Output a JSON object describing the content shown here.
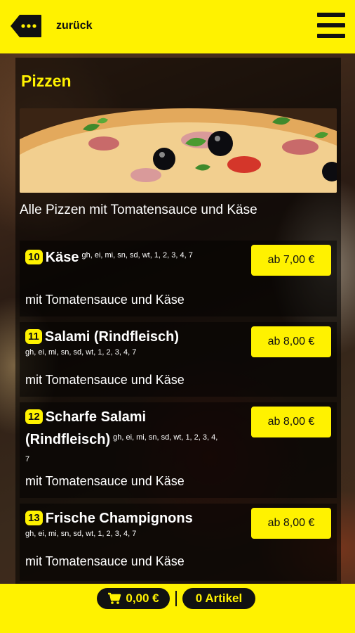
{
  "header": {
    "back_label": "zurück",
    "back_icon": "back-tag-icon",
    "menu_icon": "hamburger-menu-icon"
  },
  "category": {
    "title": "Pizzen",
    "description": "Alle Pizzen mit Tomatensauce und Käse"
  },
  "items": [
    {
      "number": "10",
      "name": "Käse",
      "allergens": "gh, ei, mi, sn, sd, wt, 1, 2, 3, 4, 7",
      "description": "mit Tomatensauce und Käse",
      "price": "ab 7,00 €"
    },
    {
      "number": "11",
      "name": "Salami (Rindfleisch)",
      "allergens": "gh, ei, mi, sn, sd, wt, 1, 2, 3, 4, 7",
      "description": "mit Tomatensauce und Käse",
      "price": "ab 8,00 €"
    },
    {
      "number": "12",
      "name": "Scharfe Salami",
      "name_line2": "(Rindfleisch)",
      "allergens": "gh, ei, mi, sn, sd, wt, 1, 2, 3, 4, 7",
      "description": "mit Tomatensauce und Käse",
      "price": "ab 8,00 €"
    },
    {
      "number": "13",
      "name": "Frische Champignons",
      "allergens": "gh, ei, mi, sn, sd, wt, 1, 2, 3, 4, 7",
      "description": "mit Tomatensauce und Käse",
      "price": "ab 8,00 €"
    }
  ],
  "footer": {
    "cart_total": "0,00 €",
    "cart_icon": "shopping-cart-icon",
    "article_count": "0 Artikel"
  },
  "colors": {
    "accent": "#fff200",
    "dark": "#111111"
  }
}
